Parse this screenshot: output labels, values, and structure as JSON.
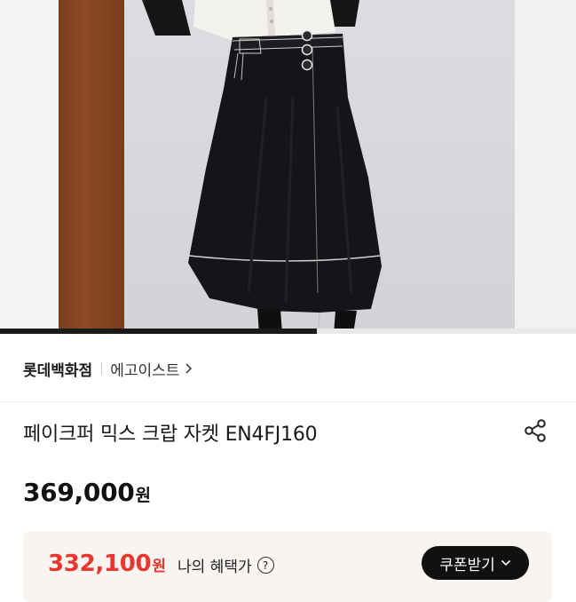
{
  "product_image": {
    "alt_icon": "product-photo",
    "carousel_progress": 0.55
  },
  "brand": {
    "store": "롯데백화점",
    "name": "에고이스트",
    "chevron_icon": "chevron-right-icon"
  },
  "product": {
    "title": "페이크퍼 믹스 크랍 자켓 EN4FJ160",
    "share_icon": "share-icon"
  },
  "price": {
    "amount": "369,000",
    "unit": "원"
  },
  "benefit": {
    "amount": "332,100",
    "unit": "원",
    "label": "나의 혜택가",
    "help_symbol": "?",
    "coupon_button": "쿠폰받기",
    "coupon_icon": "chevron-down-icon",
    "accent": "#e8372c"
  }
}
